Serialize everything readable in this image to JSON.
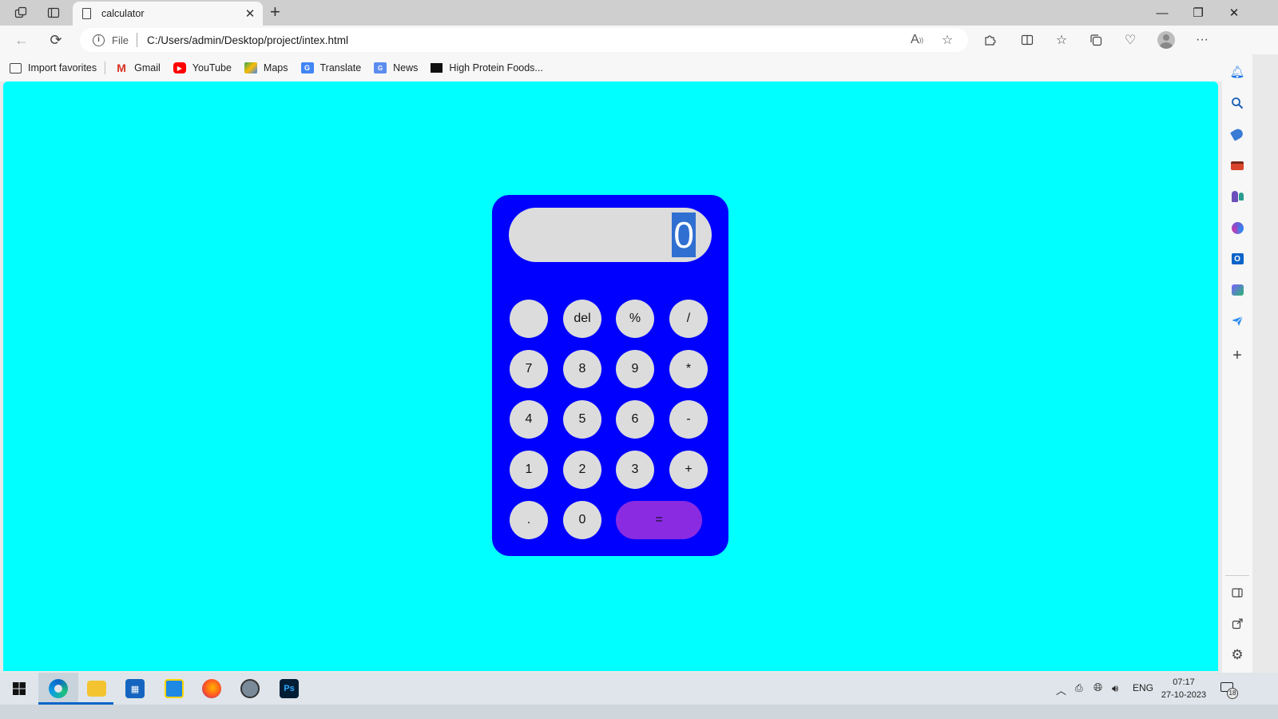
{
  "browser": {
    "tab_title": "calculator",
    "tab_close": "✕",
    "new_tab": "+",
    "window_controls": {
      "minimize": "—",
      "restore": "❐",
      "close": "✕"
    },
    "address": {
      "file_label": "File",
      "url": "C:/Users/admin/Desktop/project/intex.html"
    },
    "read_aloud": "A",
    "more": "···"
  },
  "favorites": [
    {
      "label": "Import favorites",
      "icon": "import-icon"
    },
    {
      "label": "Gmail",
      "icon": "gmail-icon",
      "color": "#d93025"
    },
    {
      "label": "YouTube",
      "icon": "youtube-icon",
      "color": "#ff0000"
    },
    {
      "label": "Maps",
      "icon": "maps-icon",
      "color": "#34a853"
    },
    {
      "label": "Translate",
      "icon": "translate-icon",
      "color": "#4285f4"
    },
    {
      "label": "News",
      "icon": "news-icon",
      "color": "#5b8def"
    },
    {
      "label": "High Protein Foods...",
      "icon": "bookmark-site-icon",
      "color": "#111111"
    }
  ],
  "calculator": {
    "display": "0",
    "keys": [
      [
        "",
        "del",
        "%",
        "/"
      ],
      [
        "7",
        "8",
        "9",
        "*"
      ],
      [
        "4",
        "5",
        "6",
        "-"
      ],
      [
        "1",
        "2",
        "3",
        "+"
      ],
      [
        ".",
        "0",
        "="
      ]
    ],
    "colors": {
      "page_bg": "#00ffff",
      "body": "#0000ff",
      "key": "#dcdcdc",
      "equals": "#8a2be2"
    }
  },
  "taskbar": {
    "language": "ENG",
    "time": "07:17",
    "date": "27-10-2023",
    "notifications": "18"
  }
}
